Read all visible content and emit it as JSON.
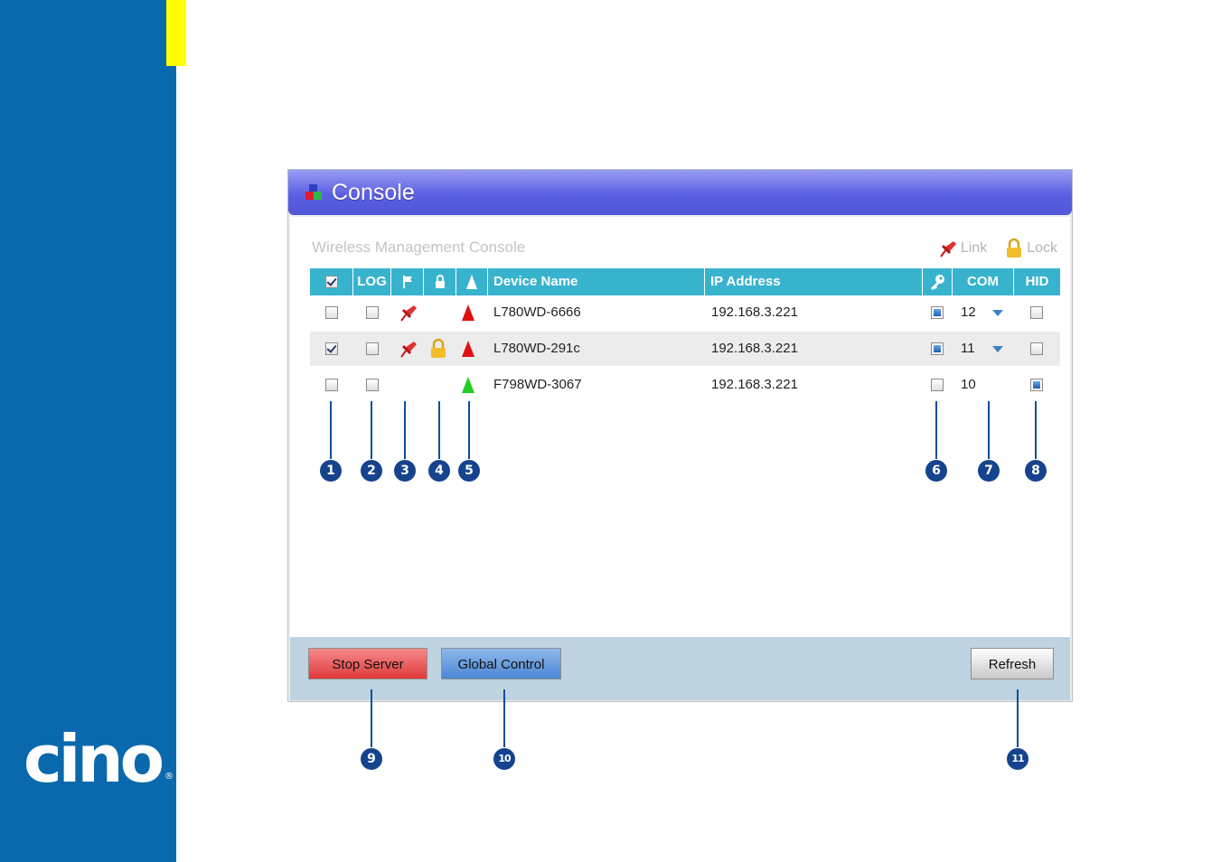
{
  "brand": {
    "logo_text": "cino",
    "registered": "®"
  },
  "window": {
    "title": "Console"
  },
  "panel": {
    "subtitle": "Wireless Management Console"
  },
  "legend": {
    "link_label": "Link",
    "lock_label": "Lock"
  },
  "table": {
    "headers": {
      "log": "LOG",
      "device_name": "Device Name",
      "ip_address": "IP Address",
      "com": "COM",
      "hid": "HID"
    },
    "header_select_all_checked": true,
    "rows": [
      {
        "selected": false,
        "log": false,
        "linked": true,
        "locked": false,
        "signal": "red",
        "device_name": "L780WD-6666",
        "ip": "192.168.3.221",
        "key": true,
        "com": "12",
        "com_dropdown": true,
        "hid": false
      },
      {
        "selected": true,
        "log": false,
        "linked": true,
        "locked": true,
        "signal": "red",
        "device_name": "L780WD-291c",
        "ip": "192.168.3.221",
        "key": true,
        "com": "11",
        "com_dropdown": true,
        "hid": false
      },
      {
        "selected": false,
        "log": false,
        "linked": false,
        "locked": false,
        "signal": "green",
        "device_name": "F798WD-3067",
        "ip": "192.168.3.221",
        "key": false,
        "com": "10",
        "com_dropdown": false,
        "hid": true
      }
    ]
  },
  "footer": {
    "stop_server": "Stop Server",
    "global_control": "Global Control",
    "refresh": "Refresh"
  },
  "callouts": [
    "1",
    "2",
    "3",
    "4",
    "5",
    "6",
    "7",
    "8",
    "9",
    "10",
    "11"
  ],
  "colors": {
    "sidebar": "#0a69ac",
    "accent_yellow": "#ffff00",
    "titlebar": "#5b60e2",
    "table_header": "#38b3ce",
    "signal_red": "#e01010",
    "signal_green": "#22cc22",
    "callout": "#16438e"
  }
}
